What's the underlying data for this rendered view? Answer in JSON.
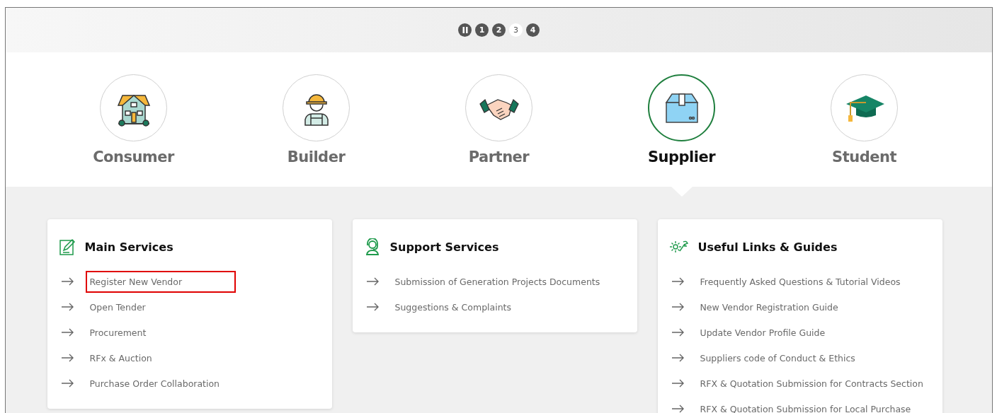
{
  "slider_controls": [
    {
      "kind": "pause",
      "selected": false
    },
    {
      "kind": "number",
      "label": "1",
      "selected": false
    },
    {
      "kind": "number",
      "label": "2",
      "selected": false
    },
    {
      "kind": "number",
      "label": "3",
      "selected": true
    },
    {
      "kind": "number",
      "label": "4",
      "selected": false
    }
  ],
  "audiences": [
    {
      "kind": "house",
      "label": "Consumer",
      "selected": false
    },
    {
      "kind": "worker",
      "label": "Builder",
      "selected": false
    },
    {
      "kind": "handshake",
      "label": "Partner",
      "selected": false
    },
    {
      "kind": "box",
      "label": "Supplier",
      "selected": true
    },
    {
      "kind": "cap",
      "label": "Student",
      "selected": false
    }
  ],
  "cards": [
    {
      "kind": "edit",
      "title": "Main Services",
      "links": [
        {
          "label": "Register New Vendor",
          "highlighted": true
        },
        {
          "label": "Open Tender",
          "highlighted": false
        },
        {
          "label": "Procurement",
          "highlighted": false
        },
        {
          "label": "RFx & Auction",
          "highlighted": false
        },
        {
          "label": "Purchase Order Collaboration",
          "highlighted": false
        }
      ]
    },
    {
      "kind": "support",
      "title": "Support Services",
      "links": [
        {
          "label": "Submission of Generation Projects Documents",
          "highlighted": false
        },
        {
          "label": "Suggestions & Complaints",
          "highlighted": false
        }
      ]
    },
    {
      "kind": "tools",
      "title": "Useful Links & Guides",
      "links": [
        {
          "label": "Frequently Asked Questions & Tutorial Videos",
          "highlighted": false
        },
        {
          "label": "New Vendor Registration Guide",
          "highlighted": false
        },
        {
          "label": "Update Vendor Profile Guide",
          "highlighted": false
        },
        {
          "label": "Suppliers code of Conduct & Ethics",
          "highlighted": false
        },
        {
          "label": "RFX & Quotation Submission for Contracts Section",
          "highlighted": false
        },
        {
          "label": "RFX & Quotation Submission for Local Purchase",
          "highlighted": false
        }
      ]
    }
  ]
}
